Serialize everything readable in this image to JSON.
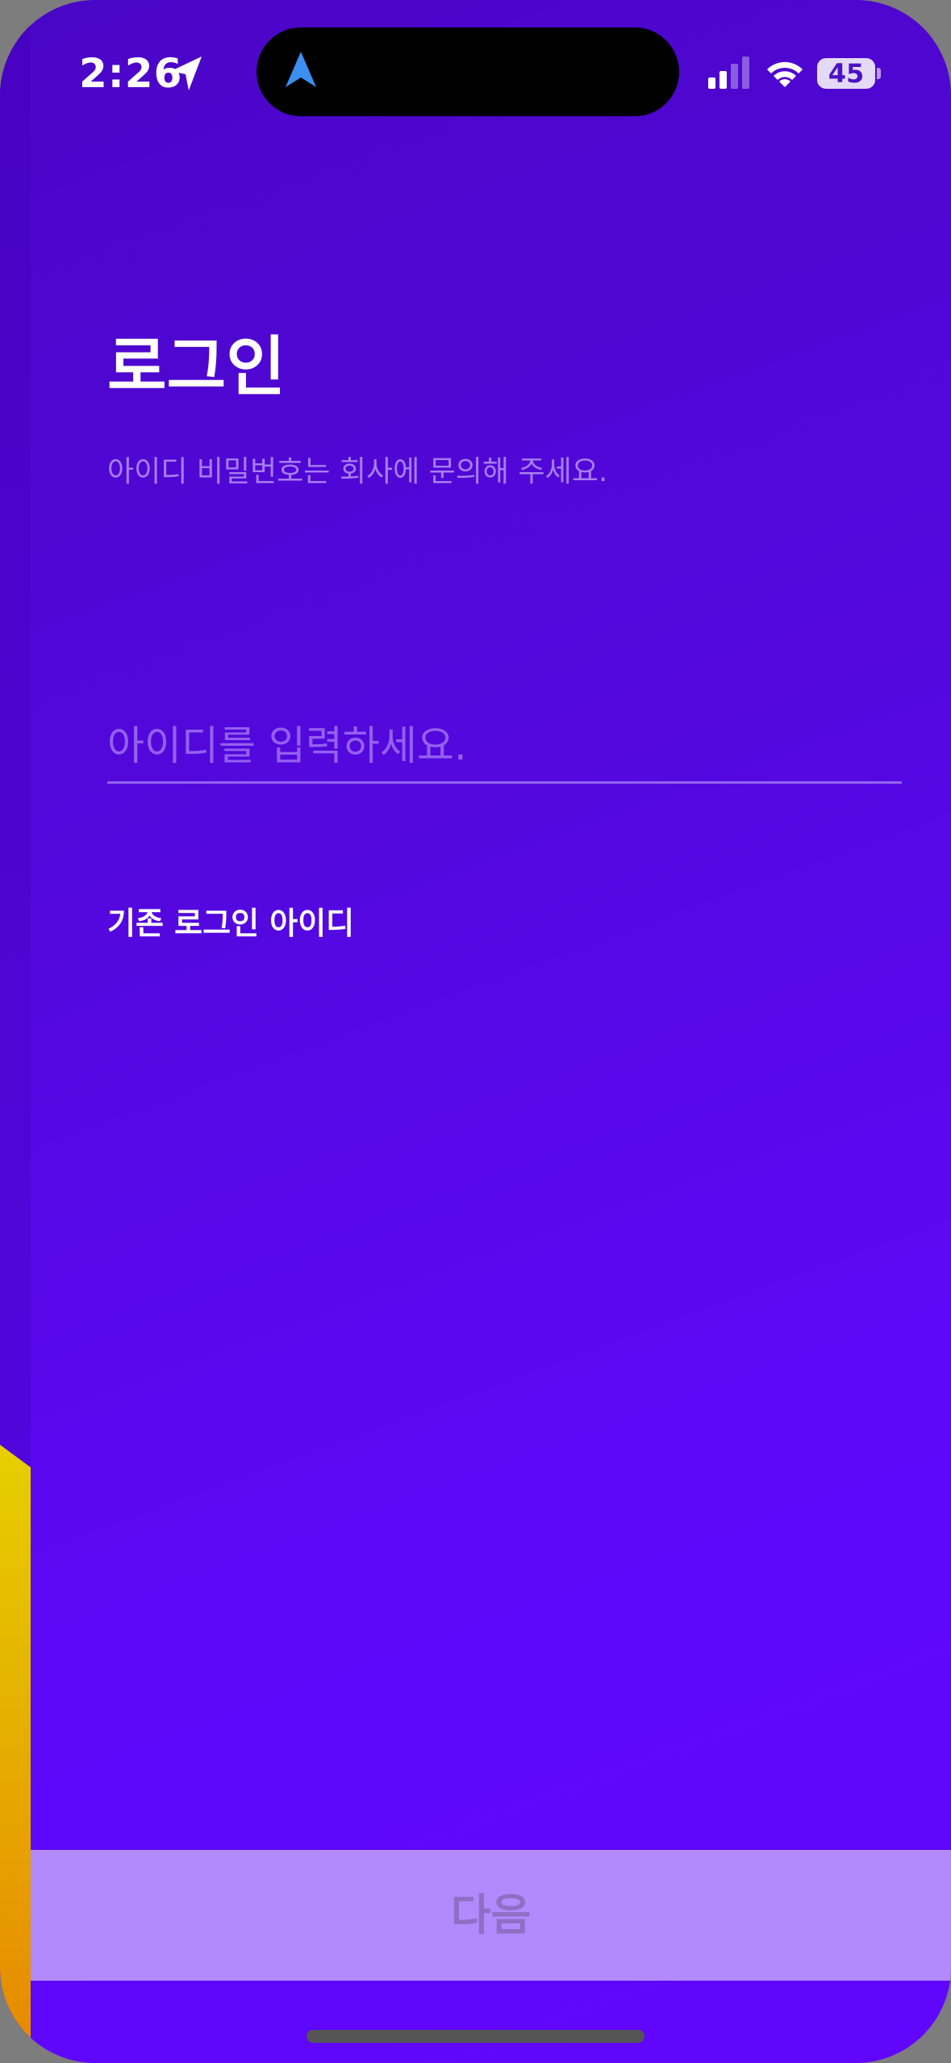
{
  "status_bar": {
    "time": "2:26",
    "battery": "45",
    "icons": [
      "location-arrow-icon",
      "navigation-icon",
      "cellular-signal-icon",
      "wifi-icon",
      "battery-icon"
    ]
  },
  "login": {
    "title": "로그인",
    "subtitle": "아이디 비밀번호는 회사에 문의해 주세요.",
    "id_placeholder": "아이디를 입력하세요.",
    "id_value": "",
    "previous_ids_label": "기존 로그인 아이디",
    "next_label": "다음"
  },
  "colors": {
    "background": "#5e08fb",
    "button": "#b28afd",
    "button_text": "#8e6fc4",
    "nav_arrow": "#3b8ff0"
  }
}
